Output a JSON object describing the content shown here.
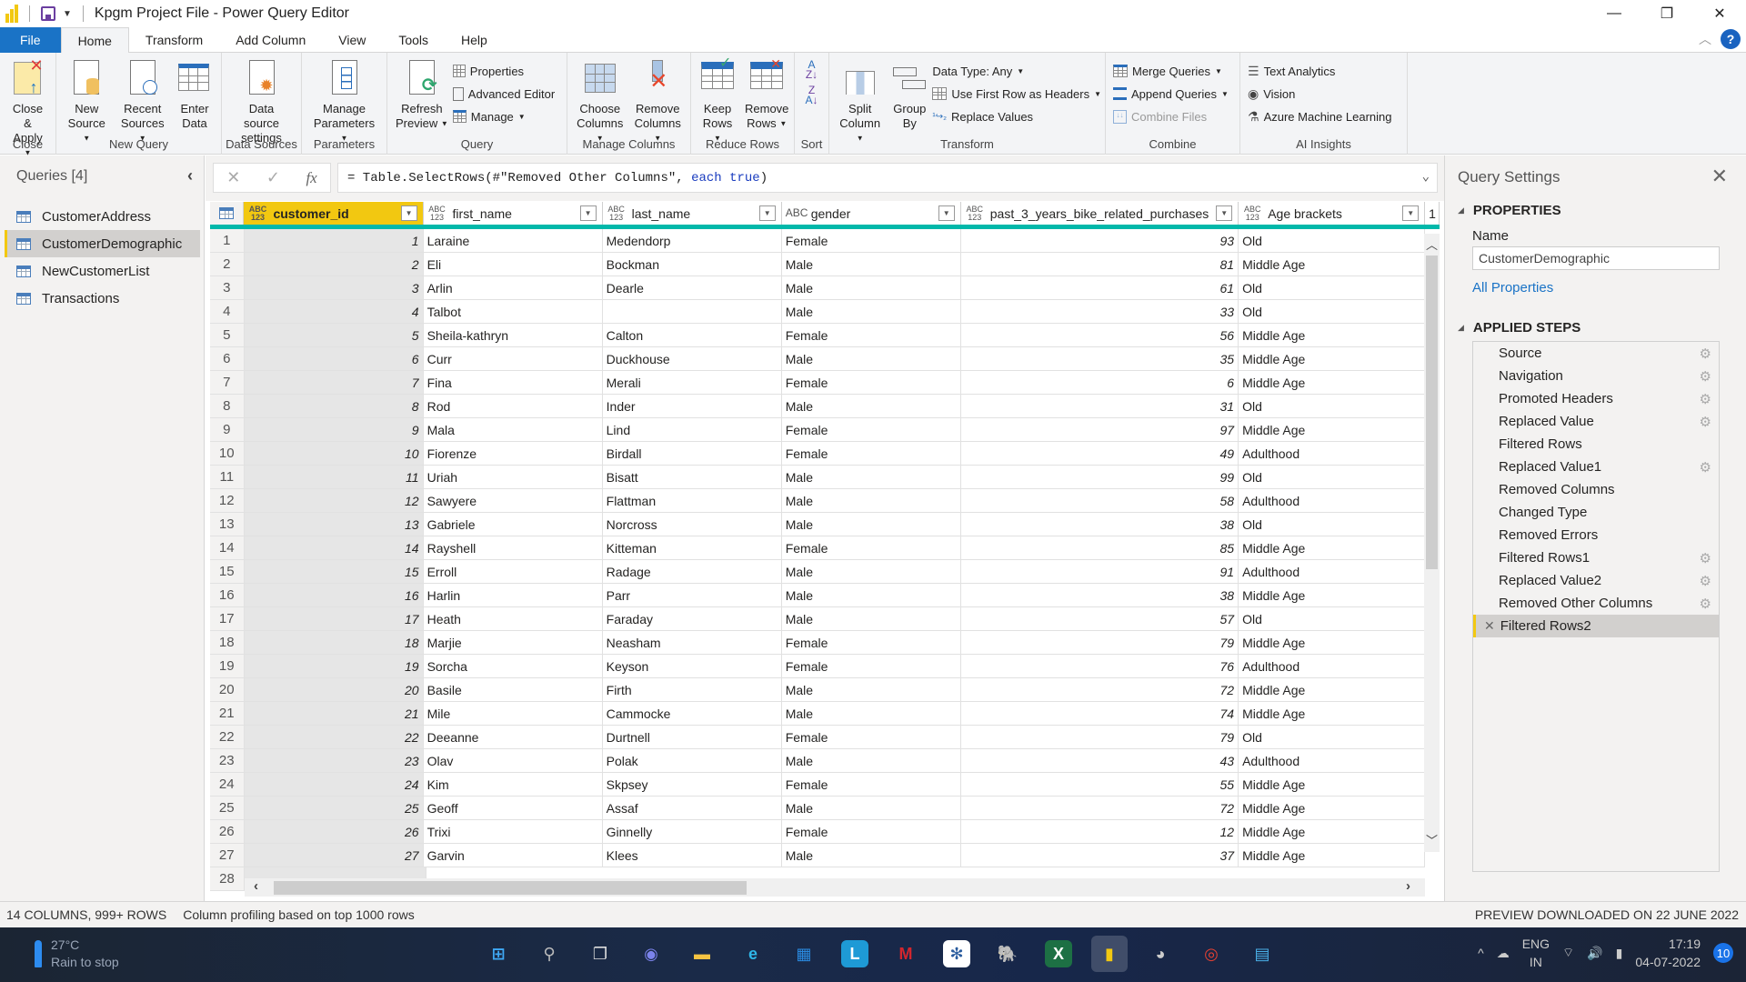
{
  "window": {
    "title": "Kpgm Project File - Power Query Editor",
    "controls": {
      "minimize": "—",
      "restore": "❐",
      "close": "✕"
    }
  },
  "tabs": [
    {
      "label": "File"
    },
    {
      "label": "Home"
    },
    {
      "label": "Transform"
    },
    {
      "label": "Add Column"
    },
    {
      "label": "View"
    },
    {
      "label": "Tools"
    },
    {
      "label": "Help"
    }
  ],
  "ribbon": {
    "close": {
      "label": "Close",
      "close_apply": "Close &",
      "close_apply2": "Apply"
    },
    "new_query": {
      "label": "New Query",
      "new_source": "New",
      "new_source2": "Source",
      "recent_sources": "Recent",
      "recent_sources2": "Sources",
      "enter_data": "Enter",
      "enter_data2": "Data"
    },
    "data_sources": {
      "label": "Data Sources",
      "settings": "Data source",
      "settings2": "settings"
    },
    "parameters": {
      "label": "Parameters",
      "manage": "Manage",
      "manage2": "Parameters"
    },
    "query": {
      "label": "Query",
      "refresh": "Refresh",
      "refresh2": "Preview",
      "properties": "Properties",
      "advanced_editor": "Advanced Editor",
      "manage": "Manage"
    },
    "manage_columns": {
      "label": "Manage Columns",
      "choose": "Choose",
      "choose2": "Columns",
      "remove": "Remove",
      "remove2": "Columns"
    },
    "reduce_rows": {
      "label": "Reduce Rows",
      "keep": "Keep",
      "keep2": "Rows",
      "remove": "Remove",
      "remove2": "Rows"
    },
    "sort": {
      "label": "Sort"
    },
    "transform": {
      "label": "Transform",
      "split": "Split",
      "split2": "Column",
      "group": "Group",
      "group2": "By",
      "data_type": "Data Type: Any",
      "first_row": "Use First Row as Headers",
      "replace": "Replace Values"
    },
    "combine": {
      "label": "Combine",
      "merge": "Merge Queries",
      "append": "Append Queries",
      "combine_files": "Combine Files"
    },
    "ai": {
      "label": "AI Insights",
      "text_analytics": "Text Analytics",
      "vision": "Vision",
      "azure_ml": "Azure Machine Learning"
    }
  },
  "queries": {
    "title": "Queries [4]",
    "items": [
      {
        "label": "CustomerAddress",
        "selected": false
      },
      {
        "label": "CustomerDemographic",
        "selected": true
      },
      {
        "label": "NewCustomerList",
        "selected": false
      },
      {
        "label": "Transactions",
        "selected": false
      }
    ]
  },
  "formula": {
    "prefix": "= Table.SelectRows(#\"Removed Other Columns\", ",
    "keyword": "each true",
    "suffix": ")"
  },
  "grid": {
    "columns": [
      {
        "type": "ABC\n123",
        "name": "customer_id",
        "selected": true
      },
      {
        "type": "ABC\n123",
        "name": "first_name"
      },
      {
        "type": "ABC\n123",
        "name": "last_name"
      },
      {
        "type": "ABC",
        "name": "gender"
      },
      {
        "type": "ABC\n123",
        "name": "past_3_years_bike_related_purchases"
      },
      {
        "type": "ABC\n123",
        "name": "Age brackets"
      }
    ],
    "next_column_hint": "1",
    "rows": [
      [
        1,
        "Laraine",
        "Medendorp",
        "Female",
        93,
        "Old"
      ],
      [
        2,
        "Eli",
        "Bockman",
        "Male",
        81,
        "Middle Age"
      ],
      [
        3,
        "Arlin",
        "Dearle",
        "Male",
        61,
        "Old"
      ],
      [
        4,
        "Talbot",
        "",
        "Male",
        33,
        "Old"
      ],
      [
        5,
        "Sheila-kathryn",
        "Calton",
        "Female",
        56,
        "Middle Age"
      ],
      [
        6,
        "Curr",
        "Duckhouse",
        "Male",
        35,
        "Middle Age"
      ],
      [
        7,
        "Fina",
        "Merali",
        "Female",
        6,
        "Middle Age"
      ],
      [
        8,
        "Rod",
        "Inder",
        "Male",
        31,
        "Old"
      ],
      [
        9,
        "Mala",
        "Lind",
        "Female",
        97,
        "Middle Age"
      ],
      [
        10,
        "Fiorenze",
        "Birdall",
        "Female",
        49,
        "Adulthood"
      ],
      [
        11,
        "Uriah",
        "Bisatt",
        "Male",
        99,
        "Old"
      ],
      [
        12,
        "Sawyere",
        "Flattman",
        "Male",
        58,
        "Adulthood"
      ],
      [
        13,
        "Gabriele",
        "Norcross",
        "Male",
        38,
        "Old"
      ],
      [
        14,
        "Rayshell",
        "Kitteman",
        "Female",
        85,
        "Middle Age"
      ],
      [
        15,
        "Erroll",
        "Radage",
        "Male",
        91,
        "Adulthood"
      ],
      [
        16,
        "Harlin",
        "Parr",
        "Male",
        38,
        "Middle Age"
      ],
      [
        17,
        "Heath",
        "Faraday",
        "Male",
        57,
        "Old"
      ],
      [
        18,
        "Marjie",
        "Neasham",
        "Female",
        79,
        "Middle Age"
      ],
      [
        19,
        "Sorcha",
        "Keyson",
        "Female",
        76,
        "Adulthood"
      ],
      [
        20,
        "Basile",
        "Firth",
        "Male",
        72,
        "Middle Age"
      ],
      [
        21,
        "Mile",
        "Cammocke",
        "Male",
        74,
        "Middle Age"
      ],
      [
        22,
        "Deeanne",
        "Durtnell",
        "Female",
        79,
        "Old"
      ],
      [
        23,
        "Olav",
        "Polak",
        "Male",
        43,
        "Adulthood"
      ],
      [
        24,
        "Kim",
        "Skpsey",
        "Female",
        55,
        "Middle Age"
      ],
      [
        25,
        "Geoff",
        "Assaf",
        "Male",
        72,
        "Middle Age"
      ],
      [
        26,
        "Trixi",
        "Ginnelly",
        "Female",
        12,
        "Middle Age"
      ],
      [
        27,
        "Garvin",
        "Klees",
        "Male",
        37,
        "Middle Age"
      ]
    ],
    "partial_row_number": "28"
  },
  "settings": {
    "title": "Query Settings",
    "properties_header": "PROPERTIES",
    "name_label": "Name",
    "name_value": "CustomerDemographic",
    "all_properties": "All Properties",
    "steps_header": "APPLIED STEPS",
    "steps": [
      {
        "label": "Source",
        "gear": true
      },
      {
        "label": "Navigation",
        "gear": true
      },
      {
        "label": "Promoted Headers",
        "gear": true
      },
      {
        "label": "Replaced Value",
        "gear": true
      },
      {
        "label": "Filtered Rows",
        "gear": false
      },
      {
        "label": "Replaced Value1",
        "gear": true
      },
      {
        "label": "Removed Columns",
        "gear": false
      },
      {
        "label": "Changed Type",
        "gear": false
      },
      {
        "label": "Removed Errors",
        "gear": false
      },
      {
        "label": "Filtered Rows1",
        "gear": true
      },
      {
        "label": "Replaced Value2",
        "gear": true
      },
      {
        "label": "Removed Other Columns",
        "gear": true
      },
      {
        "label": "Filtered Rows2",
        "gear": false,
        "selected": true
      }
    ]
  },
  "status": {
    "columns_rows": "14 COLUMNS, 999+ ROWS",
    "profiling": "Column profiling based on top 1000 rows",
    "preview": "PREVIEW DOWNLOADED ON 22 JUNE 2022"
  },
  "taskbar": {
    "weather_temp": "27°C",
    "weather_desc": "Rain to stop",
    "apps": [
      "start",
      "search",
      "task-view",
      "teams-chat",
      "file-explorer",
      "edge",
      "store",
      "app-l",
      "mcafee",
      "tableau",
      "postgresql",
      "excel",
      "power-bi",
      "dbeaver",
      "chrome",
      "notepad"
    ],
    "lang1": "ENG",
    "lang2": "IN",
    "time": "17:19",
    "date": "04-07-2022",
    "notifications": "10"
  },
  "colors": {
    "accent_file_tab": "#1a73c6",
    "selected_column": "#f2c811",
    "quality_bar": "#01b8aa",
    "link": "#1a73c6"
  }
}
